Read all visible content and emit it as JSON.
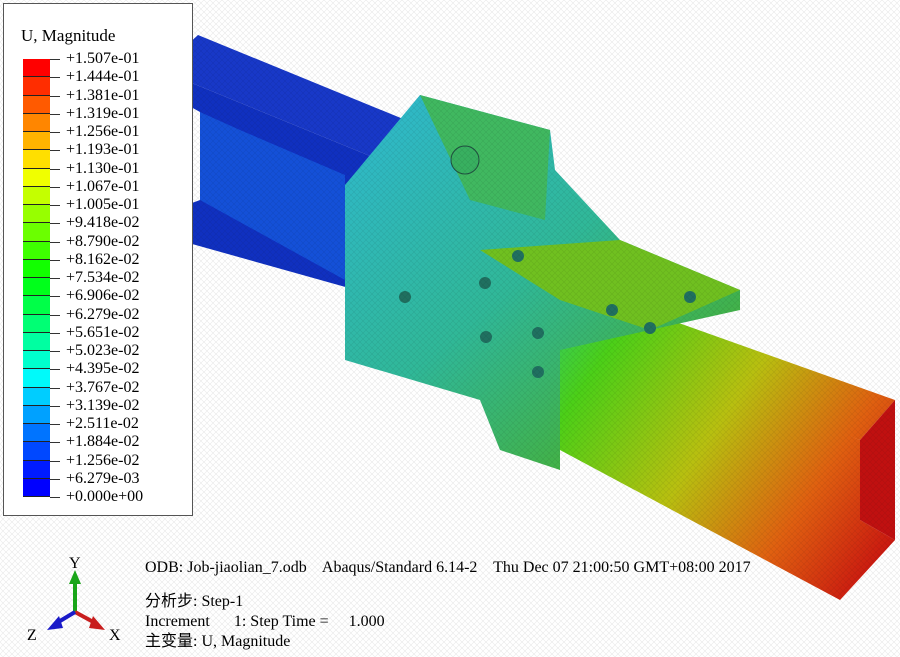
{
  "legend": {
    "title": "U, Magnitude",
    "labels": [
      "+1.507e-01",
      "+1.444e-01",
      "+1.381e-01",
      "+1.319e-01",
      "+1.256e-01",
      "+1.193e-01",
      "+1.130e-01",
      "+1.067e-01",
      "+1.005e-01",
      "+9.418e-02",
      "+8.790e-02",
      "+8.162e-02",
      "+7.534e-02",
      "+6.906e-02",
      "+6.279e-02",
      "+5.651e-02",
      "+5.023e-02",
      "+4.395e-02",
      "+3.767e-02",
      "+3.139e-02",
      "+2.511e-02",
      "+1.884e-02",
      "+1.256e-02",
      "+6.279e-03",
      "+0.000e+00"
    ],
    "band_colors": [
      "#ff0000",
      "#ff2d00",
      "#ff5a00",
      "#ff8600",
      "#ffb300",
      "#ffdf00",
      "#f0ff00",
      "#c4ff00",
      "#97ff00",
      "#6bff00",
      "#3eff00",
      "#12ff00",
      "#00ff1b",
      "#00ff48",
      "#00ff74",
      "#00ffa1",
      "#00ffcd",
      "#00fafa",
      "#00cdff",
      "#00a1ff",
      "#0074ff",
      "#0048ff",
      "#001bff",
      "#0000ff"
    ]
  },
  "info": {
    "odb": "ODB: Job-jiaolian_7.odb    Abaqus/Standard 6.14-2    Thu Dec 07 21:00:50 GMT+08:00 2017",
    "step": "分析步: Step-1",
    "increment": "Increment      1: Step Time =     1.000",
    "variable": "主变量: U, Magnitude"
  },
  "triad": {
    "y": "Y",
    "x": "X",
    "z": "Z"
  }
}
